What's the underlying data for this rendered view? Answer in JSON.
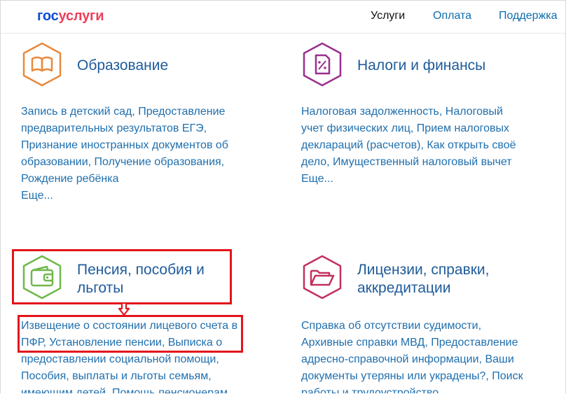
{
  "header": {
    "logo_part1": "гос",
    "logo_part2": "услуги",
    "nav": [
      "Услуги",
      "Оплата",
      "Поддержка"
    ]
  },
  "categories": [
    {
      "title": "Образование",
      "icon": "book-icon",
      "color": "#e9893c",
      "links": "Запись в детский сад, Предоставление предварительных результатов ЕГЭ, Признание иностранных документов об образовании, Получение образования, Рождение ребёнка",
      "more": "Еще..."
    },
    {
      "title": "Налоги и финансы",
      "icon": "tax-document-icon",
      "color": "#9b2f8e",
      "links": "Налоговая задолженность, Налоговый учет физических лиц, Прием налоговых деклараций (расчетов), Как открыть своё дело, Имущественный налоговый вычет",
      "more": "Еще..."
    },
    {
      "title": "Пенсия, пособия и льготы",
      "icon": "wallet-icon",
      "color": "#6fb84a",
      "links": "Извещение о состоянии лицевого счета в ПФР, Установление пенсии, Выписка о предоставлении социальной помощи, Пособия, выплаты и льготы семьям, имеющим детей, Помощь пенсионерам"
    },
    {
      "title": "Лицензии, справки, аккредитации",
      "icon": "folder-icon",
      "color": "#c2315e",
      "links": "Справка об отсутствии судимости, Архивные справки МВД, Предоставление адресно-справочной информации, Ваши документы утеряны или украдены?, Поиск работы и трудоустройство"
    }
  ],
  "annotation_color": "#e3141b"
}
